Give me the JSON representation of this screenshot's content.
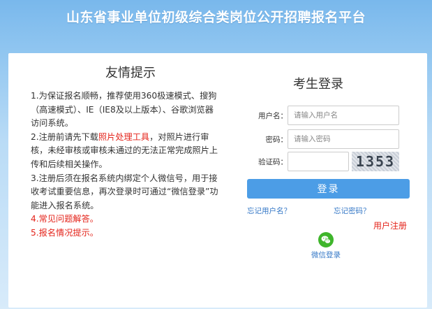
{
  "header": {
    "title": "山东省事业单位初级综合类岗位公开招聘报名平台"
  },
  "notice": {
    "title": "友情提示",
    "item1": "1.为保证报名顺畅，推荐使用360极速模式、搜狗（高速模式）、IE（IE8及以上版本）、谷歌浏览器访问系统。",
    "item2_prefix": "2.注册前请先下载",
    "item2_link": "照片处理工具",
    "item2_suffix": "，对照片进行审核，未经审核或审核未通过的无法正常完成照片上传和后续相关操作。",
    "item3": "3.注册后须在报名系统内绑定个人微信号，用于接收考试重要信息，再次登录时可通过“微信登录”功能进入报名系统。",
    "item4_prefix": "4.",
    "item4_link": "常见问题解答",
    "item4_suffix": "。",
    "item5_prefix": "5.",
    "item5_link": "报名情况提示",
    "item5_suffix": "。"
  },
  "login": {
    "title": "考生登录",
    "username_label": "用户名：",
    "username_placeholder": "请输入用户名",
    "password_label": "密码：",
    "password_placeholder": "请输入密码",
    "captcha_label": "验证码：",
    "captcha_text": "1353",
    "submit_label": "登录",
    "forgot_username": "忘记用户名？",
    "forgot_password": "忘记密码？",
    "register": "用户注册",
    "wechat_login": "微信登录"
  },
  "colors": {
    "accent": "#4c9de6",
    "link": "#3578c7",
    "warning": "#e4241b",
    "wechat": "#3fb52b"
  }
}
